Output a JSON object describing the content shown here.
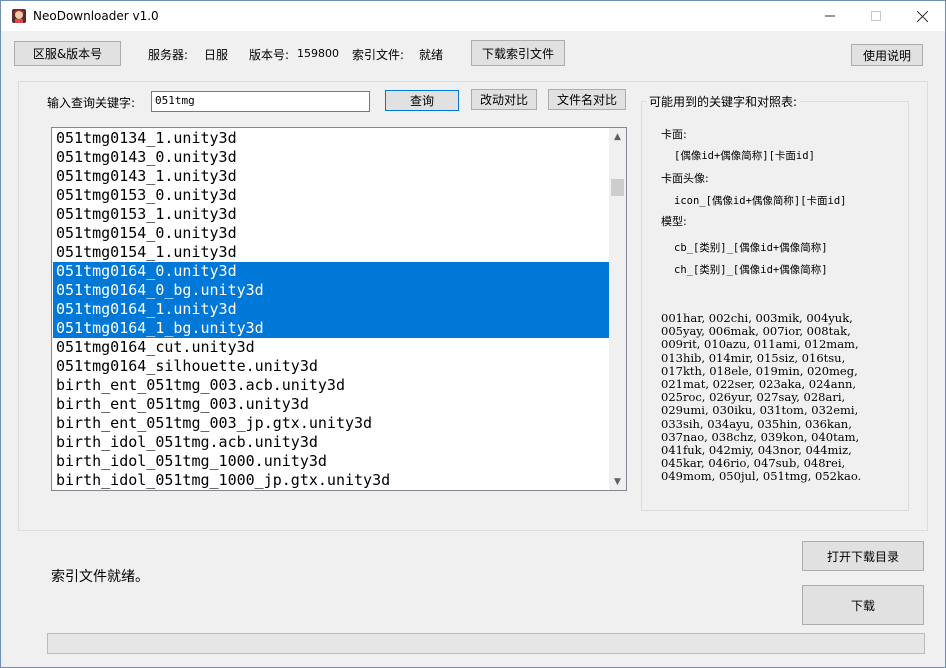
{
  "window": {
    "title": "NeoDownloader v1.0"
  },
  "toolbar": {
    "region_button": "区服&版本号",
    "server_label": "服务器:",
    "server_value": "日服",
    "version_label": "版本号:",
    "version_value": "159800",
    "index_label": "索引文件:",
    "index_value": "就绪",
    "download_index_button": "下载索引文件",
    "help_button": "使用说明"
  },
  "search": {
    "label": "输入查询关键字:",
    "value": "051tmg",
    "query_button": "查询",
    "diff_button": "改动对比",
    "filename_diff_button": "文件名对比"
  },
  "file_list": {
    "items": [
      {
        "name": "051tmg0134_1.unity3d",
        "selected": false
      },
      {
        "name": "051tmg0143_0.unity3d",
        "selected": false
      },
      {
        "name": "051tmg0143_1.unity3d",
        "selected": false
      },
      {
        "name": "051tmg0153_0.unity3d",
        "selected": false
      },
      {
        "name": "051tmg0153_1.unity3d",
        "selected": false
      },
      {
        "name": "051tmg0154_0.unity3d",
        "selected": false
      },
      {
        "name": "051tmg0154_1.unity3d",
        "selected": false
      },
      {
        "name": "051tmg0164_0.unity3d",
        "selected": true
      },
      {
        "name": "051tmg0164_0_bg.unity3d",
        "selected": true
      },
      {
        "name": "051tmg0164_1.unity3d",
        "selected": true
      },
      {
        "name": "051tmg0164_1_bg.unity3d",
        "selected": true
      },
      {
        "name": "051tmg0164_cut.unity3d",
        "selected": false
      },
      {
        "name": "051tmg0164_silhouette.unity3d",
        "selected": false
      },
      {
        "name": "birth_ent_051tmg_003.acb.unity3d",
        "selected": false
      },
      {
        "name": "birth_ent_051tmg_003.unity3d",
        "selected": false
      },
      {
        "name": "birth_ent_051tmg_003_jp.gtx.unity3d",
        "selected": false
      },
      {
        "name": "birth_idol_051tmg.acb.unity3d",
        "selected": false
      },
      {
        "name": "birth_idol_051tmg_1000.unity3d",
        "selected": false
      },
      {
        "name": "birth_idol_051tmg_1000_jp.gtx.unity3d",
        "selected": false
      }
    ],
    "scroll_up": "▲",
    "scroll_down": "▼"
  },
  "keywords": {
    "title": "可能用到的关键字和对照表:",
    "card_label": "卡面:",
    "card_pattern": "[偶像id+偶像简称][卡面id]",
    "avatar_label": "卡面头像:",
    "avatar_pattern": "icon_[偶像id+偶像简称][卡面id]",
    "model_label": "模型:",
    "model_pattern_1": "cb_[类别]_[偶像id+偶像简称]",
    "model_pattern_2": "ch_[类别]_[偶像id+偶像简称]",
    "idol_codes": [
      "001har, 002chi, 003mik, 004yuk,",
      "005yay, 006mak, 007ior, 008tak,",
      "009rit, 010azu, 011ami, 012mam,",
      "013hib, 014mir, 015siz, 016tsu,",
      "017kth, 018ele, 019min, 020meg,",
      "021mat, 022ser, 023aka, 024ann,",
      "025roc, 026yur, 027say, 028ari,",
      "029umi, 030iku, 031tom, 032emi,",
      "033sih, 034ayu, 035hin, 036kan,",
      "037nao, 038chz, 039kon, 040tam,",
      "041fuk, 042miy, 043nor, 044miz,",
      "045kar, 046rio, 047sub, 048rei,",
      "049mom, 050jul, 051tmg, 052kao."
    ]
  },
  "bottom": {
    "status": "索引文件就绪。",
    "open_folder_button": "打开下载目录",
    "download_button": "下载",
    "progress": 0
  },
  "colors": {
    "selection": "#0078d7",
    "window_bg": "#f0f0f0",
    "button_bg": "#e1e1e1"
  }
}
